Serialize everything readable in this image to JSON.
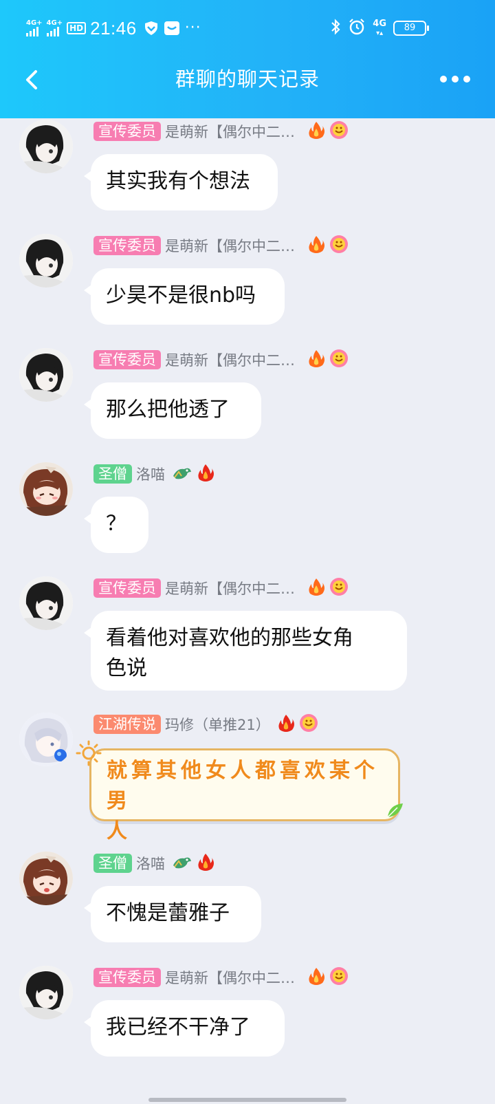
{
  "status_bar": {
    "signal1": "4G+",
    "signal2": "4G+",
    "hd": "HD",
    "time": "21:46",
    "more": "···",
    "network": "4G",
    "battery": "89"
  },
  "header": {
    "title": "群聊的聊天记录"
  },
  "colors": {
    "header": "#22b2f8",
    "badge_publicity": "#f77db1",
    "badge_saint": "#5ed38e",
    "badge_legend": "#fb8a6f",
    "fancy_text": "#f08a1c"
  },
  "messages": [
    {
      "badge": "宣传委员",
      "sender": "是萌新【偶尔中二…",
      "text": "其实我有个想法",
      "avatar": "anime-girl-black-hair"
    },
    {
      "badge": "宣传委员",
      "sender": "是萌新【偶尔中二…",
      "text": "少昊不是很nb吗",
      "avatar": "anime-girl-black-hair"
    },
    {
      "badge": "宣传委员",
      "sender": "是萌新【偶尔中二…",
      "text": "那么把他透了",
      "avatar": "anime-girl-black-hair"
    },
    {
      "badge": "圣僧",
      "sender": "洛喵",
      "text": "？",
      "avatar": "anime-girl-brown-hair"
    },
    {
      "badge": "宣传委员",
      "sender": "是萌新【偶尔中二…",
      "text_line1": "看着他对喜欢他的那些女角",
      "text_line2": "色说",
      "avatar": "anime-girl-black-hair"
    },
    {
      "badge": "江湖传说",
      "sender": "玛修（单推21）",
      "text_line1": "就算其他女人都喜欢某个男",
      "text_line2": "人",
      "avatar": "anime-girl-silver-hair"
    },
    {
      "badge": "圣僧",
      "sender": "洛喵",
      "text": "不愧是蕾雅子",
      "avatar": "anime-girl-brown-hair"
    },
    {
      "badge": "宣传委员",
      "sender": "是萌新【偶尔中二…",
      "text": "我已经不干净了",
      "avatar": "anime-girl-black-hair"
    }
  ]
}
